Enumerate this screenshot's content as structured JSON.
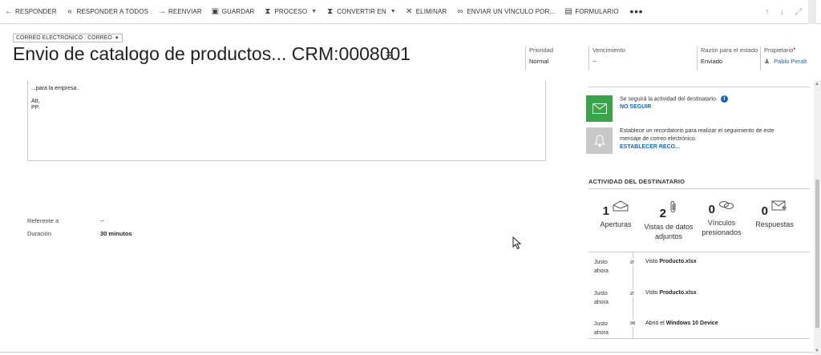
{
  "toolbar": {
    "items": [
      {
        "label": "RESPONDER",
        "icon": "←",
        "name": "reply-button",
        "icon_name": "reply-icon"
      },
      {
        "label": "RESPONDER A TODOS",
        "icon": "«",
        "name": "reply-all-button",
        "icon_name": "reply-all-icon"
      },
      {
        "label": "REENVIAR",
        "icon": "→",
        "name": "forward-button",
        "icon_name": "forward-icon"
      },
      {
        "label": "GUARDAR",
        "icon": "▣",
        "name": "save-button",
        "icon_name": "save-icon"
      },
      {
        "label": "PROCESO",
        "icon": "⧗",
        "name": "process-button",
        "icon_name": "process-icon",
        "dropdown": true
      },
      {
        "label": "CONVERTIR EN",
        "icon": "⧗",
        "name": "convert-to-button",
        "icon_name": "convert-icon",
        "dropdown": true
      },
      {
        "label": "ELIMINAR",
        "icon": "✕",
        "name": "delete-button",
        "icon_name": "delete-icon"
      },
      {
        "label": "ENVIAR UN VÍNCULO POR...",
        "icon": "∞",
        "name": "send-link-button",
        "icon_name": "link-icon"
      },
      {
        "label": "FORMULARIO",
        "icon": "▤",
        "name": "form-button",
        "icon_name": "form-icon"
      }
    ],
    "more": "•••"
  },
  "header": {
    "form_selector": "CORREO ELECTRÓNICO : CORREO",
    "title": "Envio de catalogo de productos... CRM:0008001",
    "fields": {
      "priority_label": "Prioridad",
      "priority_value": "Normal",
      "due_label": "Vencimiento",
      "due_value": "--",
      "status_reason_label": "Razón para el estado",
      "status_reason_value": "Enviado",
      "owner_label": "Propietario",
      "owner_required": "*",
      "owner_value": "Pablo Peralt"
    }
  },
  "body": {
    "line1": "...para la empresa.",
    "line2": "Att,",
    "line3": "PP."
  },
  "details": {
    "regarding_label": "Referente a",
    "regarding_value": "--",
    "duration_label": "Duración",
    "duration_value": "30 minutos"
  },
  "notifications": {
    "follow_text": "Se seguirá la actividad del destinatario.",
    "follow_link": "NO SEGUIR",
    "reminder_text": "Establece un recordatorio para realizar el seguimiento de este mensaje de correo electrónico.",
    "reminder_link": "ESTABLECER RECO..."
  },
  "activity": {
    "heading": "ACTIVIDAD DEL DESTINATARIO",
    "stats": [
      {
        "num": "1",
        "icon": "✉",
        "icon_name": "open-envelope-icon",
        "caption": "Aperturas"
      },
      {
        "num": "2",
        "icon": "⌀",
        "icon_name": "paperclip-icon",
        "caption": "Vistas de datos adjuntos"
      },
      {
        "num": "0",
        "icon": "∞",
        "icon_name": "link-icon",
        "caption": "Vínculos presionados"
      },
      {
        "num": "0",
        "icon": "✉",
        "icon_name": "reply-envelope-icon",
        "caption": "Respuestas"
      }
    ],
    "timeline": [
      {
        "when": "Justo ahora",
        "prefix": "Visto ",
        "bold": "Producto.xlsx",
        "icon_name": "paperclip-icon"
      },
      {
        "when": "Justo ahora",
        "prefix": "Visto ",
        "bold": "Producto.xlsx",
        "icon_name": "paperclip-icon"
      },
      {
        "when": "Justo ahora",
        "prefix": "Abrió el ",
        "bold": "Windows 10 Device",
        "icon_name": "open-envelope-icon"
      }
    ]
  },
  "colors": {
    "follow_green": "#3aa548",
    "reminder_gray": "#c8c8c8",
    "link_blue": "#1c64b0"
  }
}
